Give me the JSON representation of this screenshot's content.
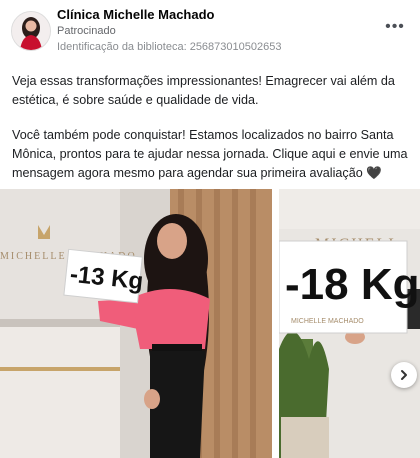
{
  "post": {
    "page_name": "Clínica Michelle Machado",
    "sponsored_label": "Patrocinado",
    "library_id": "Identificação da biblioteca: 256873010502653",
    "more_icon": "more-horizontal-icon",
    "text_p1": "Veja essas transformações impressionantes! Emagrecer vai além da estética, é sobre saúde e qualidade de vida.",
    "text_p2": "Você também pode conquistar! Estamos localizados no bairro Santa Mônica, prontos para te ajudar nessa jornada. Clique aqui e envie uma mensagem agora mesmo para agendar sua primeira avaliação 🖤"
  },
  "carousel": {
    "card1": {
      "wall_brand": "MICHELLE MACHADO",
      "sign_text": "-13 Kg"
    },
    "card2": {
      "wall_brand": "MICHELL",
      "sign_text": "-18 Kg",
      "sign_logo": "MICHELLE MACHADO"
    },
    "next_icon": "chevron-right-icon"
  },
  "colors": {
    "accent_pink": "#f05d7a",
    "wood": "#b98d66"
  }
}
